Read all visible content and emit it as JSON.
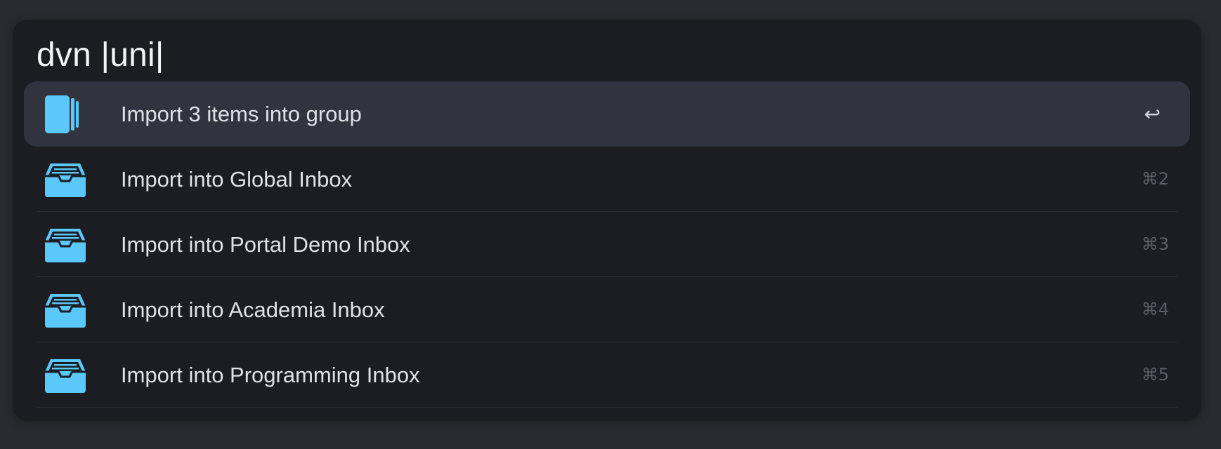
{
  "search": {
    "query": "dvn |uni|"
  },
  "results": [
    {
      "label": "Import 3 items into group",
      "shortcut": "↩",
      "icon": "group-stack-icon",
      "selected": true
    },
    {
      "label": "Import into Global Inbox",
      "shortcut": "⌘2",
      "icon": "inbox-tray-icon",
      "selected": false
    },
    {
      "label": "Import into Portal Demo Inbox",
      "shortcut": "⌘3",
      "icon": "inbox-tray-icon",
      "selected": false
    },
    {
      "label": "Import into Academia Inbox",
      "shortcut": "⌘4",
      "icon": "inbox-tray-icon",
      "selected": false
    },
    {
      "label": "Import into Programming Inbox",
      "shortcut": "⌘5",
      "icon": "inbox-tray-icon",
      "selected": false
    }
  ],
  "colors": {
    "background": "#2a2b30",
    "panel": "#1b1d23",
    "selected_row": "#31343f",
    "icon_accent": "#5ac8fa",
    "text": "#dfe1e6",
    "shortcut_text": "#5b5e66"
  }
}
